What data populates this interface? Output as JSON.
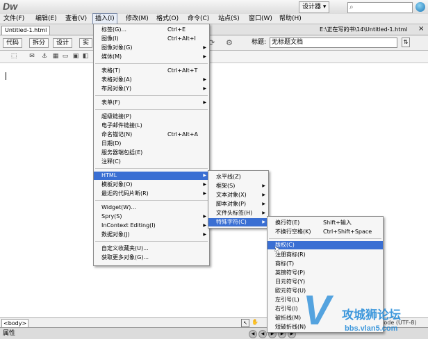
{
  "app": {
    "logo": "Dw",
    "workspace": "设计器 ▾",
    "help_icon": "help-orb-icon"
  },
  "menubar": {
    "items": [
      "文件(F)",
      "编辑(E)",
      "查看(V)",
      "插入(I)",
      "修改(M)",
      "格式(O)",
      "命令(C)",
      "站点(S)",
      "窗口(W)",
      "帮助(H)"
    ],
    "active": "插入(I)"
  },
  "document": {
    "tab": "Untitled-1.html",
    "path": "E:\\正在写的书\\14\\Untitled-1.html",
    "close": "×"
  },
  "doc_toolbar": {
    "buttons": [
      "代码",
      "拆分",
      "设计",
      "实"
    ],
    "title_label": "标题:",
    "title_value": "无标题文档"
  },
  "insert_menu": {
    "items": [
      {
        "label": "标签(G)...",
        "shortcut": "Ctrl+E"
      },
      {
        "label": "图像(I)",
        "shortcut": "Ctrl+Alt+I"
      },
      {
        "label": "图像对象(G)",
        "arrow": true
      },
      {
        "label": "媒体(M)",
        "arrow": true
      },
      {
        "label": "表格(T)",
        "shortcut": "Ctrl+Alt+T"
      },
      {
        "label": "表格对象(A)",
        "arrow": true
      },
      {
        "label": "布局对象(Y)",
        "arrow": true
      },
      {
        "label": "表单(F)",
        "arrow": true
      },
      {
        "label": "超级链接(P)"
      },
      {
        "label": "电子邮件链接(L)"
      },
      {
        "label": "命名锚记(N)",
        "shortcut": "Ctrl+Alt+A"
      },
      {
        "label": "日期(D)"
      },
      {
        "label": "服务器端包括(E)"
      },
      {
        "label": "注释(C)"
      },
      {
        "label": "HTML",
        "arrow": true,
        "highlighted": true
      },
      {
        "label": "模板对象(O)",
        "arrow": true
      },
      {
        "label": "最近的代码片断(R)",
        "arrow": true
      },
      {
        "label": "Widget(W)..."
      },
      {
        "label": "Spry(S)",
        "arrow": true
      },
      {
        "label": "InContext Editing(I)",
        "arrow": true
      },
      {
        "label": "数据对象(J)",
        "arrow": true
      },
      {
        "label": "自定义收藏夹(U)..."
      },
      {
        "label": "获取更多对象(G)..."
      }
    ]
  },
  "html_menu": {
    "items": [
      {
        "label": "水平线(Z)"
      },
      {
        "label": "框架(S)",
        "arrow": true
      },
      {
        "label": "文本对象(X)",
        "arrow": true
      },
      {
        "label": "脚本对象(P)",
        "arrow": true
      },
      {
        "label": "文件头标签(H)",
        "arrow": true
      },
      {
        "label": "特殊字符(C)",
        "arrow": true,
        "highlighted": true
      }
    ]
  },
  "special_menu": {
    "items": [
      {
        "label": "换行符(E)",
        "shortcut": "Shift+输入"
      },
      {
        "label": "不换行空格(K)",
        "shortcut": "Ctrl+Shift+Space"
      },
      {
        "label": "版权(C)",
        "highlighted": true
      },
      {
        "label": "注册商标(R)"
      },
      {
        "label": "商标(T)"
      },
      {
        "label": "英镑符号(P)"
      },
      {
        "label": "日元符号(Y)"
      },
      {
        "label": "欧元符号(U)"
      },
      {
        "label": "左引号(L)"
      },
      {
        "label": "右引号(I)"
      },
      {
        "label": "破折线(M)"
      },
      {
        "label": "短破折线(N)"
      }
    ]
  },
  "statusbar": {
    "tag": "<body>",
    "encoding": "code (UTF-8)",
    "properties": "属性"
  },
  "watermark": {
    "title": "攻城狮论坛",
    "url": "bbs.vlan5.com",
    "logo_letter": "V"
  }
}
